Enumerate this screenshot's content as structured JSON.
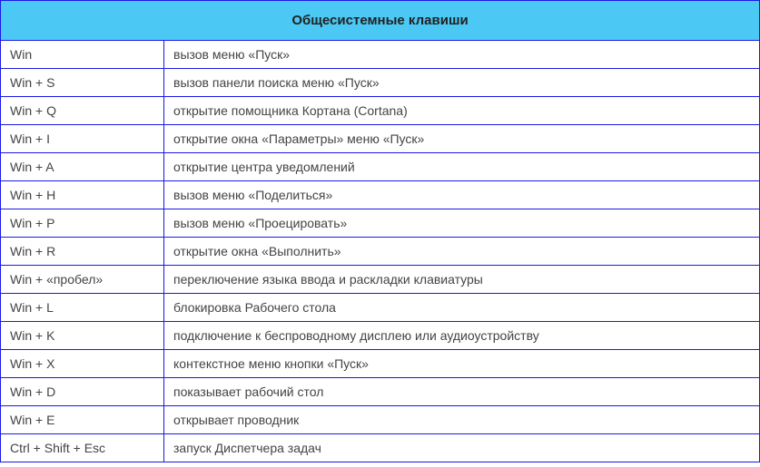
{
  "title": "Общесистемные клавиши",
  "rows": [
    {
      "key": "Win",
      "desc": "вызов меню «Пуск»"
    },
    {
      "key": "Win + S",
      "desc": "вызов панели поиска меню «Пуск»"
    },
    {
      "key": "Win + Q",
      "desc": "открытие помощника Кортана (Cortana)"
    },
    {
      "key": "Win + I",
      "desc": "открытие окна «Параметры» меню «Пуск»"
    },
    {
      "key": "Win + A",
      "desc": "открытие центра уведомлений"
    },
    {
      "key": "Win + H",
      "desc": "вызов меню «Поделиться»"
    },
    {
      "key": "Win + P",
      "desc": "вызов меню «Проецировать»"
    },
    {
      "key": "Win + R",
      "desc": "открытие окна «Выполнить»"
    },
    {
      "key": "Win + «пробел»",
      "desc": "переключение языка ввода и раскладки клавиатуры"
    },
    {
      "key": "Win + L",
      "desc": "блокировка Рабочего стола"
    },
    {
      "key": "Win + K",
      "desc": "подключение к беспроводному дисплею или аудиоустройству"
    },
    {
      "key": "Win + X",
      "desc": "контекстное меню кнопки «Пуск»"
    },
    {
      "key": "Win + D",
      "desc": "показывает рабочий стол"
    },
    {
      "key": "Win + E",
      "desc": "открывает проводник"
    },
    {
      "key": "Ctrl + Shift + Esc",
      "desc": "запуск Диспетчера задач"
    }
  ]
}
